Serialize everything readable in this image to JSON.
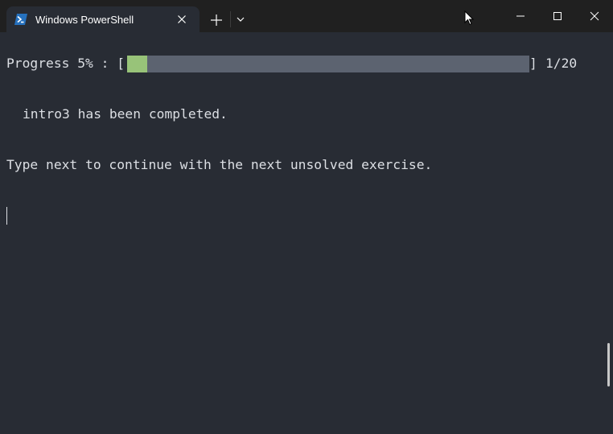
{
  "tab": {
    "title": "Windows PowerShell",
    "icon": "powershell-icon",
    "close_icon": "close-icon"
  },
  "titlebar": {
    "new_tab_icon": "plus-icon",
    "dropdown_icon": "chevron-down-icon",
    "minimize_icon": "minimize-icon",
    "maximize_icon": "maximize-icon",
    "close_icon": "close-icon"
  },
  "terminal": {
    "progress_label": "Progress 5% : [",
    "progress_close_bracket": "]",
    "progress_count": "1/20",
    "progress_fraction": 0.05,
    "completed_message": "intro3 has been completed.",
    "hint_message": "Type next to continue with the next unsolved exercise."
  },
  "colors": {
    "background": "#282c34",
    "titlebar": "#202020",
    "text": "#dcdfe4",
    "progress_fill": "#98c379",
    "progress_track": "#5c6370",
    "powershell_blue": "#2671be"
  }
}
